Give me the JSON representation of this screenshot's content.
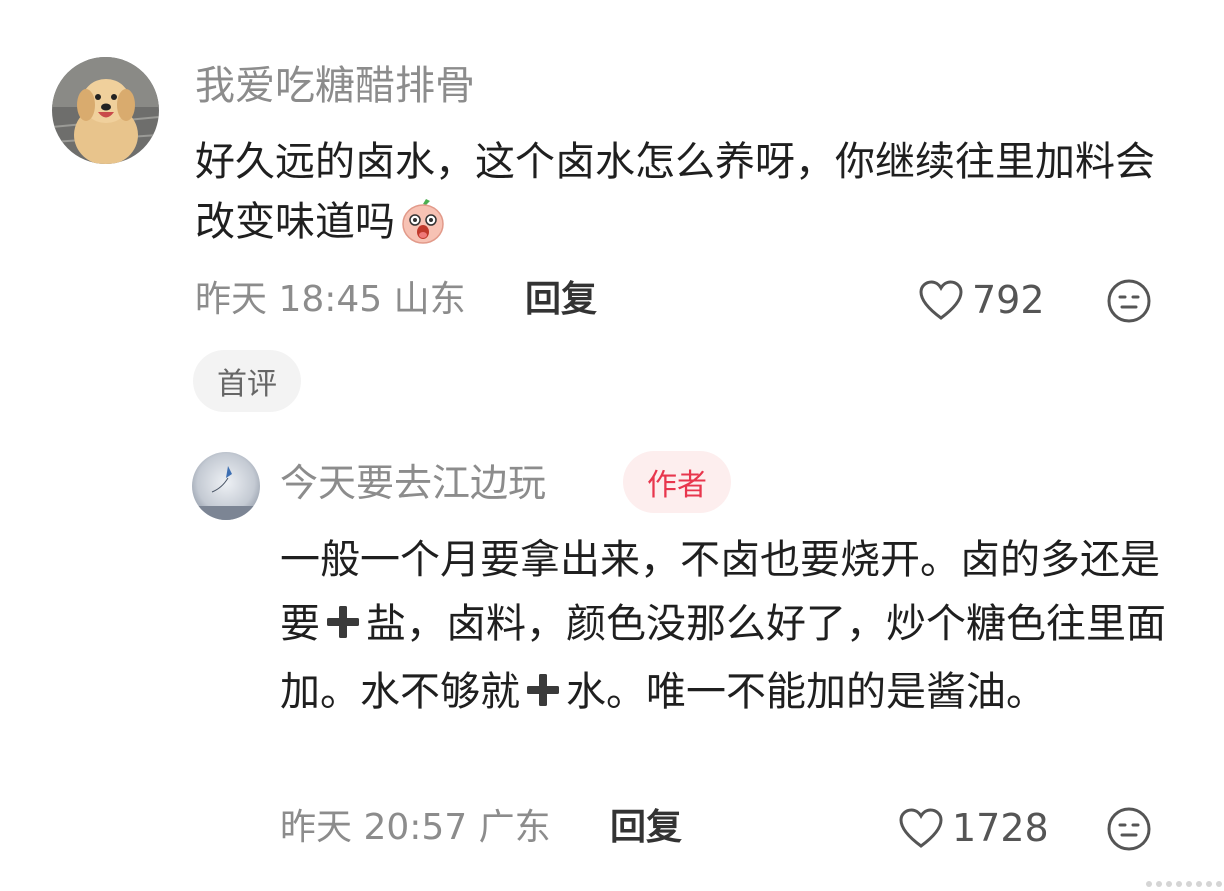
{
  "comment": {
    "username": "我爱吃糖醋排骨",
    "text": "好久远的卤水，这个卤水怎么养呀，你继续往里加料会改变味道吗",
    "emoji_icon": "surprised-face-icon",
    "time": "昨天 18:45",
    "location": "山东",
    "reply_label": "回复",
    "likes": "792",
    "first_badge": "首评"
  },
  "reply": {
    "username": "今天要去江边玩",
    "author_badge": "作者",
    "text_parts": [
      "一般一个月要拿出来，不卤也要烧开。卤的多还是要",
      "盐，卤料，颜色没那么好了，炒个糖色往里面加。水不够就",
      "水。唯一不能加的是酱油。"
    ],
    "plus_icon": "plus-icon",
    "time": "昨天 20:57",
    "location": "广东",
    "reply_label": "回复",
    "likes": "1728"
  },
  "colors": {
    "author_badge_bg": "#fdeeee",
    "author_badge_text": "#e8364d",
    "meta_text": "#8c8c8c"
  }
}
